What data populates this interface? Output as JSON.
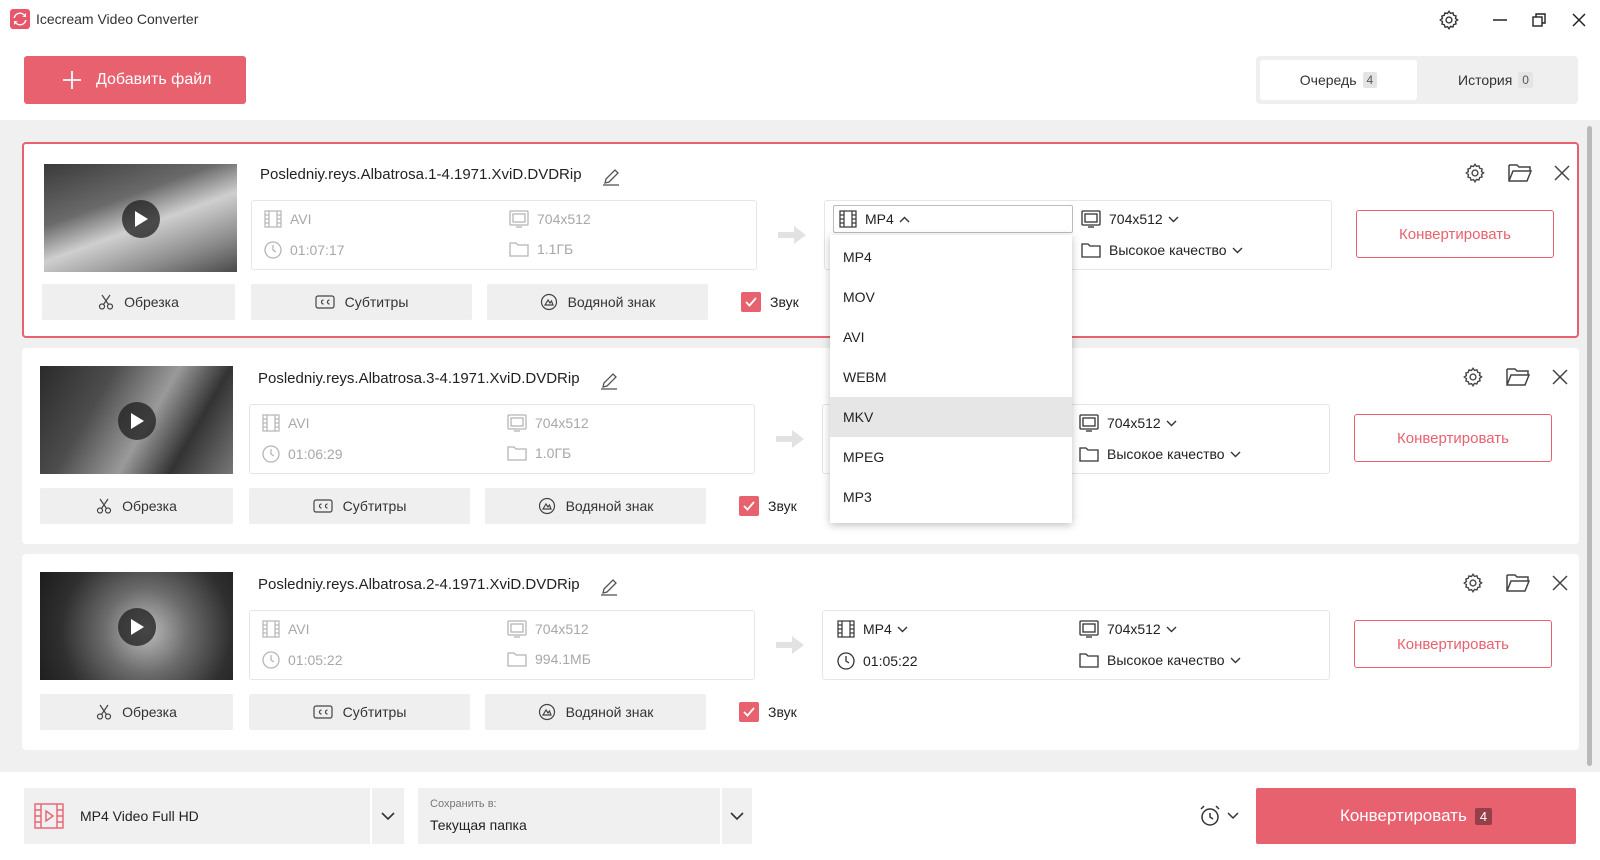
{
  "app": {
    "title": "Icecream Video Converter"
  },
  "toolbar": {
    "add_label": "Добавить файл"
  },
  "tabs": [
    {
      "label": "Очередь",
      "count": "4",
      "active": true
    },
    {
      "label": "История",
      "count": "0",
      "active": false
    }
  ],
  "files": [
    {
      "name": "Posledniy.reys.Albatrosa.1-4.1971.XviD.DVDRip",
      "src_format": "AVI",
      "src_duration": "01:07:17",
      "src_resolution": "704x512",
      "src_size": "1.1ГБ",
      "dst_format": "MP4",
      "dst_duration": "",
      "dst_resolution": "704x512",
      "dst_quality": "Высокое качество",
      "convert_label": "Конвертировать"
    },
    {
      "name": "Posledniy.reys.Albatrosa.3-4.1971.XviD.DVDRip",
      "src_format": "AVI",
      "src_duration": "01:06:29",
      "src_resolution": "704x512",
      "src_size": "1.0ГБ",
      "dst_format": "",
      "dst_duration": "",
      "dst_resolution": "704x512",
      "dst_quality": "Высокое качество",
      "convert_label": "Конвертировать"
    },
    {
      "name": "Posledniy.reys.Albatrosa.2-4.1971.XviD.DVDRip",
      "src_format": "AVI",
      "src_duration": "01:05:22",
      "src_resolution": "704x512",
      "src_size": "994.1МБ",
      "dst_format": "MP4",
      "dst_duration": "01:05:22",
      "dst_resolution": "704x512",
      "dst_quality": "Высокое качество",
      "convert_label": "Конвертировать"
    }
  ],
  "actions": {
    "trim": "Обрезка",
    "subtitles": "Субтитры",
    "watermark": "Водяной знак",
    "sound": "Звук"
  },
  "format_dropdown": {
    "options": [
      "MP4",
      "MOV",
      "AVI",
      "WEBM",
      "MKV",
      "MPEG",
      "MP3"
    ],
    "hovered": "MKV"
  },
  "bottom": {
    "preset": "MP4 Video Full HD",
    "save_label": "Сохранить в:",
    "save_value": "Текущая папка",
    "convert_label": "Конвертировать",
    "convert_count": "4"
  },
  "colors": {
    "accent": "#e8616f",
    "list_bg": "#f0f0f0"
  }
}
